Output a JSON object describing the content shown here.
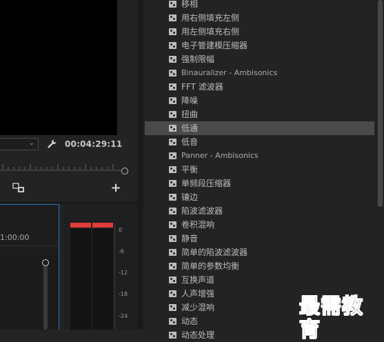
{
  "monitor": {
    "timecode": "00:04:29:11"
  },
  "icons": {
    "wrench": "wrench-icon",
    "split": "split-view-icon",
    "plus": "+",
    "chevron": "⌄"
  },
  "timeline": {
    "tick_label": "1:00:00"
  },
  "meter": {
    "db_labels": [
      "0",
      "-6",
      "-12",
      "-18",
      "-24"
    ],
    "peak_color": "#e23b3b"
  },
  "effects": {
    "items": [
      {
        "label": "移相"
      },
      {
        "label": "用右侧填充左侧"
      },
      {
        "label": "用左侧填充右侧"
      },
      {
        "label": "电子管建模压缩器"
      },
      {
        "label": "强制限幅"
      },
      {
        "label": "Binauralizer - Ambisonics"
      },
      {
        "label": "FFT 滤波器"
      },
      {
        "label": "降噪"
      },
      {
        "label": "扭曲"
      },
      {
        "label": "低通"
      },
      {
        "label": "低音"
      },
      {
        "label": "Panner - Ambisonics"
      },
      {
        "label": "平衡"
      },
      {
        "label": "单频段压缩器"
      },
      {
        "label": "镶边"
      },
      {
        "label": "陷波滤波器"
      },
      {
        "label": "卷积混响"
      },
      {
        "label": "静音"
      },
      {
        "label": "简单的陷波滤波器"
      },
      {
        "label": "简单的参数均衡"
      },
      {
        "label": "互换声道"
      },
      {
        "label": "人声增强"
      },
      {
        "label": "减少混响"
      },
      {
        "label": "动态"
      },
      {
        "label": "动态处理"
      }
    ],
    "selected_index": 9
  },
  "watermark": "最需教育"
}
